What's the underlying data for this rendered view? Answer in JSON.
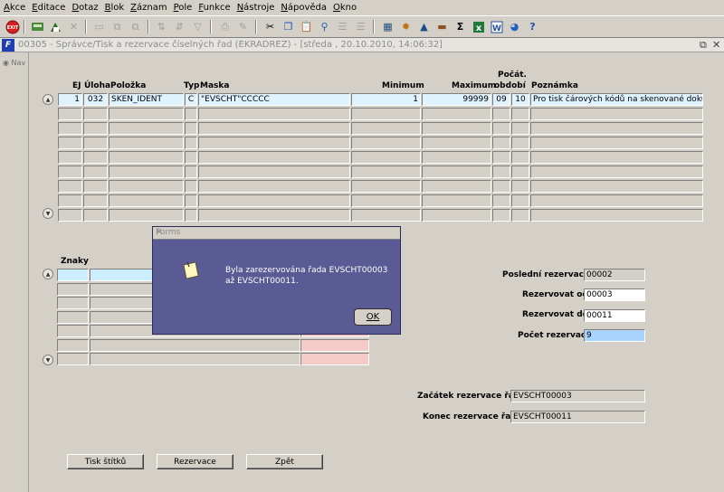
{
  "menu": [
    "Akce",
    "Editace",
    "Dotaz",
    "Blok",
    "Záznam",
    "Pole",
    "Funkce",
    "Nástroje",
    "Nápověda",
    "Okno"
  ],
  "toolbar": {
    "exit_label": "EXIT",
    "icons": [
      "save-icon",
      "insert-icon",
      "delete-icon",
      "clear-icon",
      "enter-query-icon",
      "execute-query-icon",
      "cancel-query-icon",
      "sort-asc-icon",
      "sort-desc-icon",
      "filter-icon",
      "print-icon",
      "edit-icon",
      "cut-icon",
      "copy-icon",
      "paste-icon",
      "find-icon",
      "list-icon",
      "calculator-icon",
      "sun-icon",
      "triangle-icon",
      "toolbox-icon",
      "sigma-icon",
      "excel-icon",
      "word-icon",
      "chart-icon",
      "help-icon"
    ]
  },
  "window": {
    "title": "00305 - Správce/Tisk a rezervace číselných řad (EKRADREZ) - [středa , 20.10.2010, 14:06:32]",
    "app_icon": "F"
  },
  "nav": {
    "label": "Nav"
  },
  "table": {
    "headers": {
      "ej": "EJ",
      "uloha": "Úloha",
      "polozka": "Položka",
      "typ": "Typ",
      "maska": "Maska",
      "minimum": "Minimum",
      "maximum": "Maximum",
      "pocat": "Počát.",
      "obdobi": "období",
      "poznamka": "Poznámka"
    },
    "row1": {
      "ej": "1",
      "uloha": "032",
      "polozka": "SKEN_IDENT",
      "typ": "C",
      "maska": "\"EVSCHT\"CCCCC",
      "minimum": "1",
      "maximum": "99999",
      "pocat": "09",
      "obdobi": "10",
      "poznamka": "Pro tisk čárových kódů na skenované dokumenty"
    }
  },
  "znaky": {
    "label": "Znaky"
  },
  "dialog": {
    "title": "Forms",
    "message": "Byla zarezervována řada EVSCHT00003 až EVSCHT00011.",
    "ok_label": "OK"
  },
  "form": {
    "posledni_label": "Poslední rezervace",
    "posledni_value": "00002",
    "od_label": "Rezervovat od",
    "od_value": "00003",
    "do_label": "Rezervovat do",
    "do_value": "00011",
    "pocet_label": "Počet rezervací",
    "pocet_value": "9",
    "zacatek_label": "Začátek rezervace řady",
    "zacatek_value": "EVSCHT00003",
    "konec_label": "Konec rezervace řady",
    "konec_value": "EVSCHT00011"
  },
  "buttons": {
    "tisk": "Tisk štítků",
    "rezervace": "Rezervace",
    "zpet": "Zpět"
  }
}
